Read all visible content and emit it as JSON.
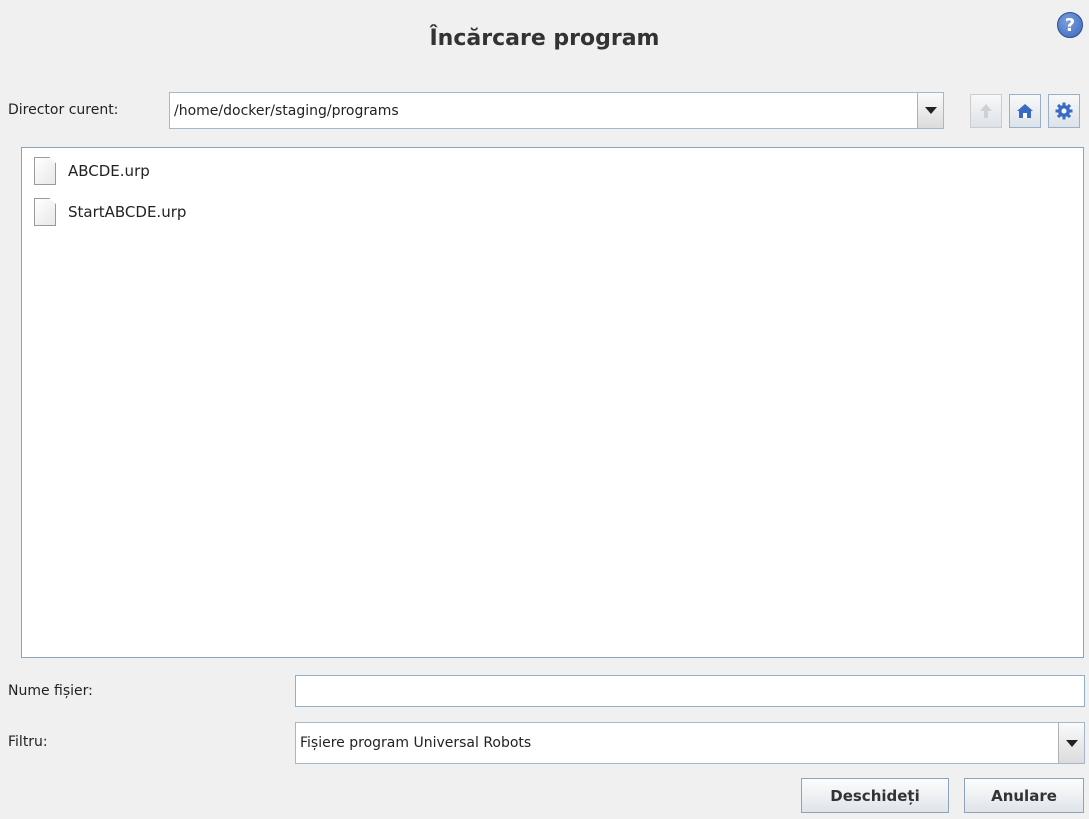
{
  "dialog": {
    "title": "Încărcare program",
    "help_icon": "question-icon"
  },
  "directory": {
    "label": "Director curent:",
    "path": "/home/docker/staging/programs",
    "icons": [
      "arrow-up-icon",
      "home-icon",
      "gear-icon"
    ]
  },
  "files": [
    {
      "name": "ABCDE.urp",
      "icon": "file-icon"
    },
    {
      "name": "StartABCDE.urp",
      "icon": "file-icon"
    }
  ],
  "filename": {
    "label": "Nume fișier:",
    "value": ""
  },
  "filter": {
    "label": "Filtru:",
    "selected": "Fișiere program Universal Robots"
  },
  "buttons": {
    "open": "Deschideți",
    "cancel": "Anulare"
  }
}
